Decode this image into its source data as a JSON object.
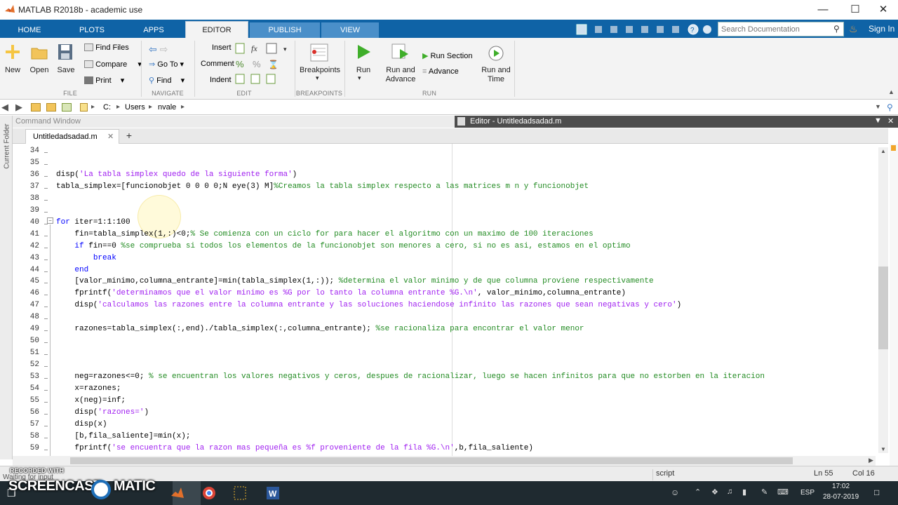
{
  "window": {
    "title": "MATLAB R2018b - academic use"
  },
  "tabs": [
    {
      "label": "HOME"
    },
    {
      "label": "PLOTS"
    },
    {
      "label": "APPS"
    },
    {
      "label": "EDITOR"
    },
    {
      "label": "PUBLISH"
    },
    {
      "label": "VIEW"
    }
  ],
  "search": {
    "placeholder": "Search Documentation"
  },
  "signin": "Sign In",
  "ribbon": {
    "file": {
      "new": "New",
      "open": "Open",
      "save": "Save",
      "find_files": "Find Files",
      "compare": "Compare",
      "print": "Print",
      "group": "FILE"
    },
    "navigate": {
      "go_to": "Go To",
      "find": "Find",
      "group": "NAVIGATE"
    },
    "edit": {
      "insert": "Insert",
      "comment": "Comment",
      "indent": "Indent",
      "fx": "fx",
      "group": "EDIT"
    },
    "breakpoints": {
      "label": "Breakpoints",
      "group": "BREAKPOINTS"
    },
    "run": {
      "run": "Run",
      "run_advance_1": "Run and",
      "run_advance_2": "Advance",
      "run_section": "Run Section",
      "advance": "Advance",
      "run_time_1": "Run and",
      "run_time_2": "Time",
      "group": "RUN"
    }
  },
  "address": {
    "path": [
      "C:",
      "Users",
      "nvale"
    ]
  },
  "panels": {
    "command_window": "Command Window",
    "editor_title": "Editor - Untitledadsadad.m",
    "current_folder": "Current Folder"
  },
  "file_tab": {
    "name": "Untitledadsadad.m",
    "close": "✕",
    "add": "+"
  },
  "code_lines": [
    {
      "n": "34",
      "segs": []
    },
    {
      "n": "35",
      "segs": []
    },
    {
      "n": "36",
      "segs": [
        {
          "t": "disp(",
          "c": ""
        },
        {
          "t": "'La tabla simplex quedo de la siguiente forma'",
          "c": "str"
        },
        {
          "t": ")",
          "c": ""
        }
      ]
    },
    {
      "n": "37",
      "segs": [
        {
          "t": "tabla_simplex=[funcionobjet 0 0 0 0;N eye(3) M]",
          "c": ""
        },
        {
          "t": "%Creamos la tabla simplex respecto a las matrices m n y funcionobjet",
          "c": "cm"
        }
      ]
    },
    {
      "n": "38",
      "segs": []
    },
    {
      "n": "39",
      "segs": []
    },
    {
      "n": "40",
      "segs": [
        {
          "t": "for",
          "c": "kw"
        },
        {
          "t": " iter=1:1:100",
          "c": ""
        }
      ]
    },
    {
      "n": "41",
      "segs": [
        {
          "t": "    fin=tabla_simplex(1,:)<0;",
          "c": ""
        },
        {
          "t": "% Se comienza con un ciclo for para hacer el algoritmo con un maximo de 100 iteraciones",
          "c": "cm"
        }
      ]
    },
    {
      "n": "42",
      "segs": [
        {
          "t": "    ",
          "c": ""
        },
        {
          "t": "if",
          "c": "kw"
        },
        {
          "t": " fin==0 ",
          "c": ""
        },
        {
          "t": "%se comprueba si todos los elementos de la funcionobjet son menores a cero, si no es asi, estamos en el optimo",
          "c": "cm"
        }
      ]
    },
    {
      "n": "43",
      "segs": [
        {
          "t": "        ",
          "c": ""
        },
        {
          "t": "break",
          "c": "kw"
        }
      ]
    },
    {
      "n": "44",
      "segs": [
        {
          "t": "    ",
          "c": ""
        },
        {
          "t": "end",
          "c": "kw"
        }
      ]
    },
    {
      "n": "45",
      "segs": [
        {
          "t": "    [valor_minimo,columna_entrante]=min(tabla_simplex(1,:)); ",
          "c": ""
        },
        {
          "t": "%determina el valor minimo y de que columna proviene respectivamente",
          "c": "cm"
        }
      ]
    },
    {
      "n": "46",
      "segs": [
        {
          "t": "    fprintf(",
          "c": ""
        },
        {
          "t": "'determinamos que el valor minimo es %G por lo tanto la columna entrante %G.\\n'",
          "c": "str"
        },
        {
          "t": ", valor_minimo,columna_entrante)",
          "c": ""
        }
      ]
    },
    {
      "n": "47",
      "segs": [
        {
          "t": "    disp(",
          "c": ""
        },
        {
          "t": "'calculamos las razones entre la columna entrante y las soluciones haciendose infinito las razones que sean negativas y cero'",
          "c": "str"
        },
        {
          "t": ")",
          "c": ""
        }
      ]
    },
    {
      "n": "48",
      "segs": []
    },
    {
      "n": "49",
      "segs": [
        {
          "t": "    razones=tabla_simplex(:,end)./tabla_simplex(:,columna_entrante); ",
          "c": ""
        },
        {
          "t": "%se racionaliza para encontrar el valor menor",
          "c": "cm"
        }
      ]
    },
    {
      "n": "50",
      "segs": []
    },
    {
      "n": "51",
      "segs": []
    },
    {
      "n": "52",
      "segs": []
    },
    {
      "n": "53",
      "segs": [
        {
          "t": "    neg=razones<=0; ",
          "c": ""
        },
        {
          "t": "% se encuentran los valores negativos y ceros, despues de racionalizar, luego se hacen infinitos para que no estorben en la iteracion",
          "c": "cm"
        }
      ]
    },
    {
      "n": "54",
      "segs": [
        {
          "t": "    x=razones;",
          "c": ""
        }
      ]
    },
    {
      "n": "55",
      "segs": [
        {
          "t": "    x(neg)=inf;",
          "c": ""
        }
      ]
    },
    {
      "n": "56",
      "segs": [
        {
          "t": "    disp(",
          "c": ""
        },
        {
          "t": "'razones='",
          "c": "str"
        },
        {
          "t": ")",
          "c": ""
        }
      ]
    },
    {
      "n": "57",
      "segs": [
        {
          "t": "    disp(x)",
          "c": ""
        }
      ]
    },
    {
      "n": "58",
      "segs": [
        {
          "t": "    [b,fila_saliente]=min(x);",
          "c": ""
        }
      ]
    },
    {
      "n": "59",
      "segs": [
        {
          "t": "    fprintf(",
          "c": ""
        },
        {
          "t": "'se encuentra que la razon mas pequeña es %f proveniente de la fila %G.\\n'",
          "c": "str"
        },
        {
          "t": ",b,fila_saliente)",
          "c": ""
        }
      ]
    }
  ],
  "status": {
    "busy": "Waiting for input",
    "mode": "script",
    "ln": "Ln  55",
    "col": "Col  16"
  },
  "watermark": {
    "line1": "RECORDED WITH",
    "line2": "SCREENCAST",
    "line3": "MATIC"
  },
  "taskbar": {
    "lang": "ESP",
    "time": "17:02",
    "date": "28-07-2019"
  },
  "colors": {
    "tab_bar": "#0f63a6",
    "keyword": "#0000ff",
    "string": "#a020f0",
    "comment": "#228b22"
  }
}
